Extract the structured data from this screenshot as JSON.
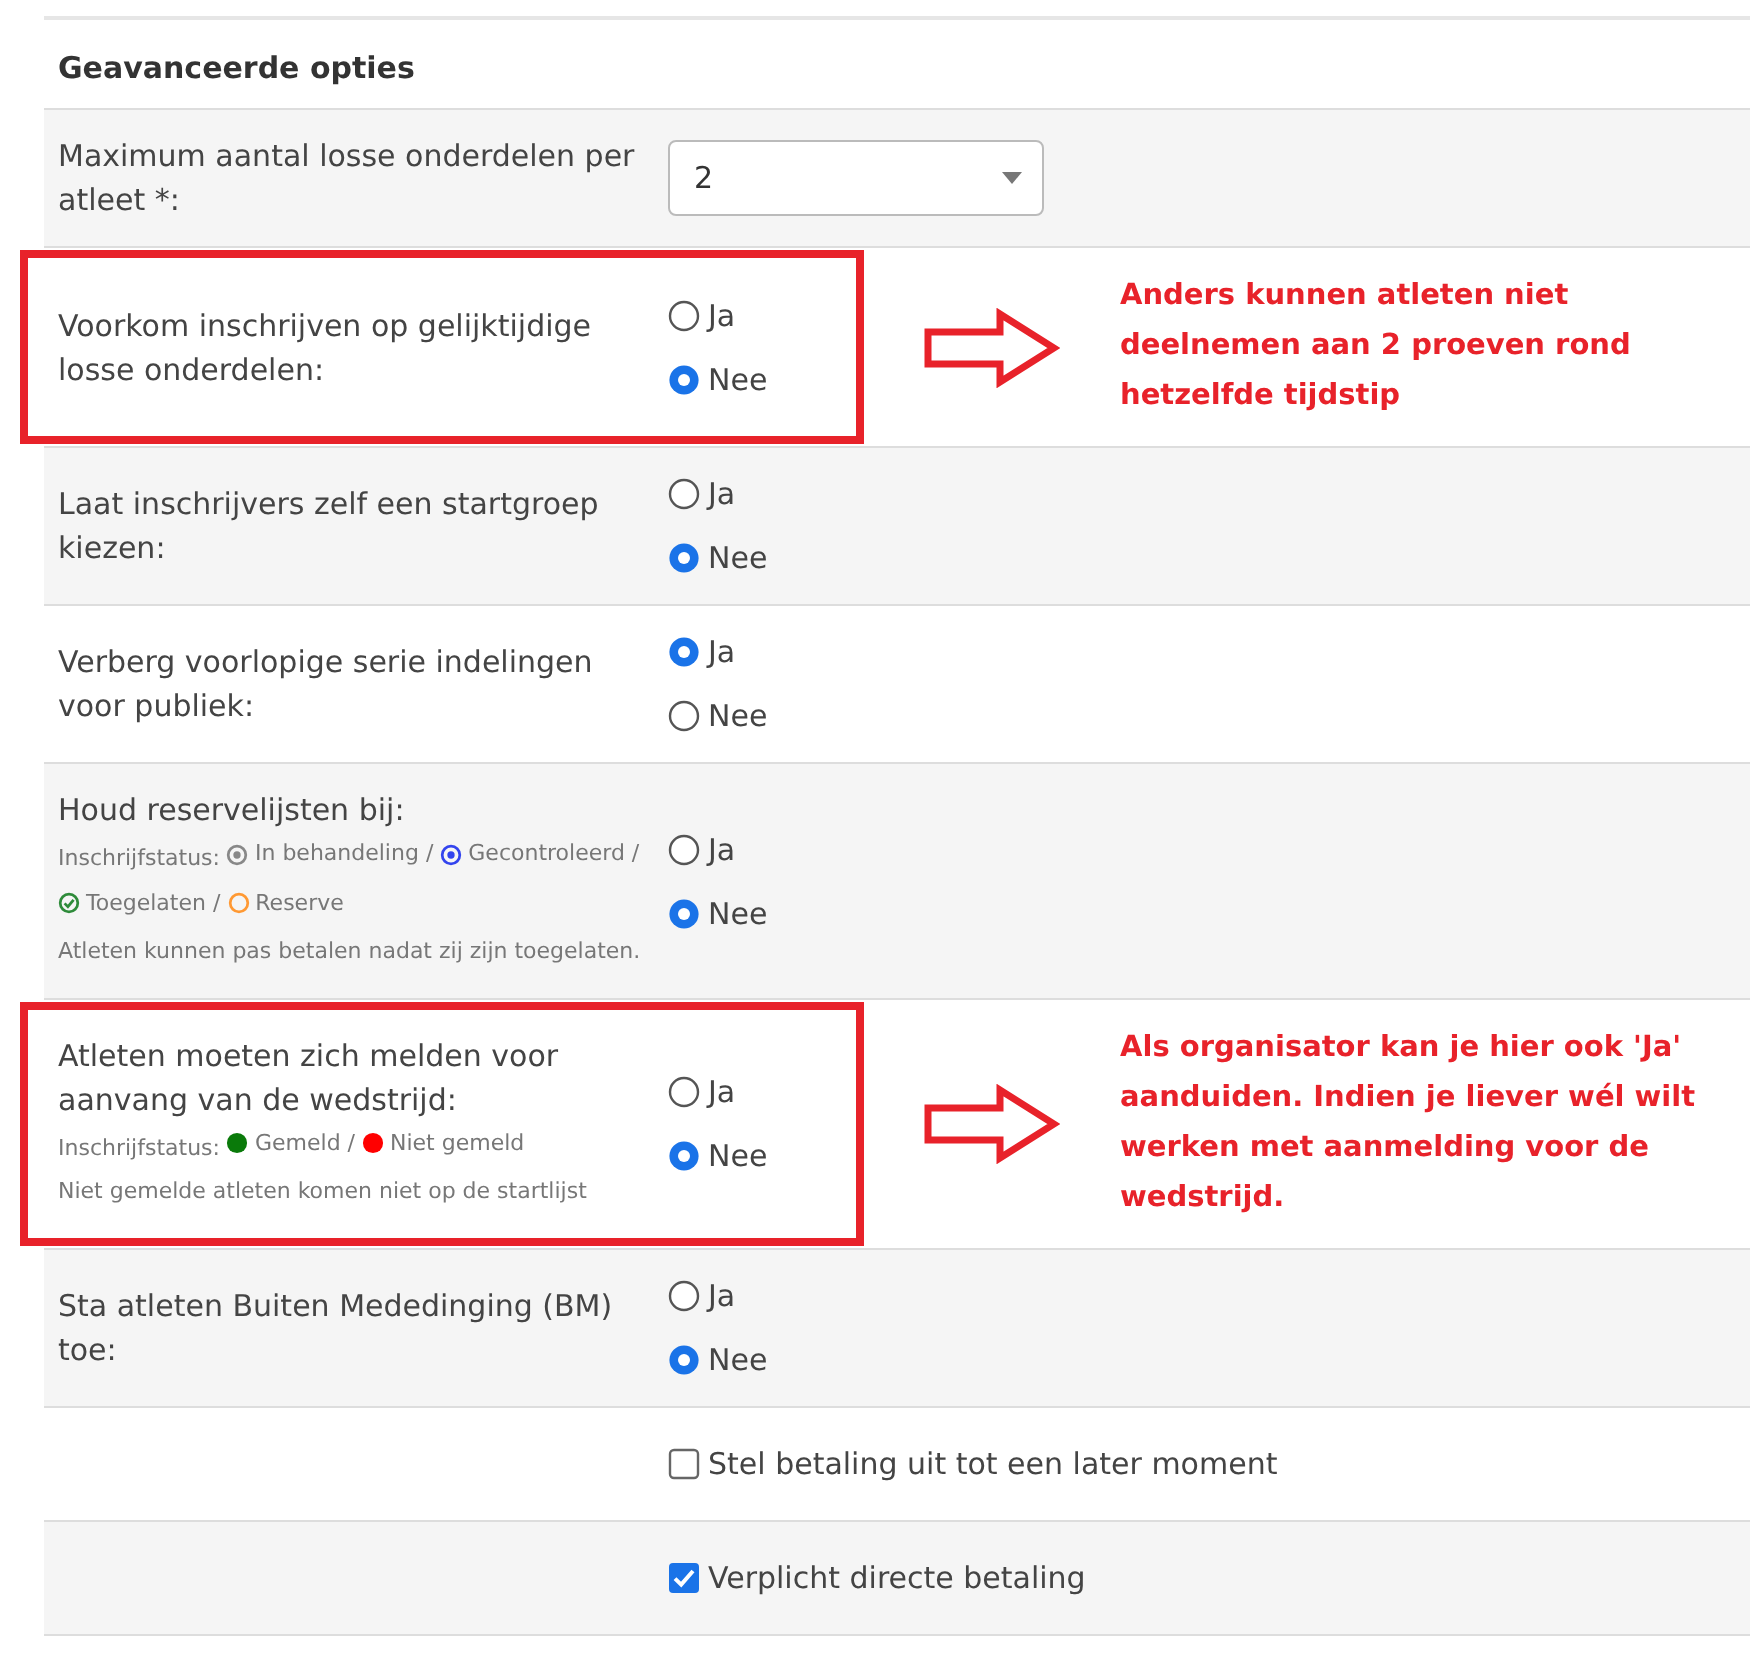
{
  "section": {
    "title": "Geavanceerde opties"
  },
  "rows": [
    {
      "kind": "select",
      "label": "Maximum aantal losse onderdelen per atleet *:",
      "value": "2"
    },
    {
      "kind": "radio",
      "label": "Voorkom inschrijven op gelijktijdige losse onderdelen:",
      "options": [
        {
          "label": "Ja",
          "selected": false
        },
        {
          "label": "Nee",
          "selected": true
        }
      ],
      "annotation": {
        "note": "Anders kunnen atleten niet deelnemen aan 2 proeven rond hetzelfde tijdstip"
      }
    },
    {
      "kind": "radio",
      "label": "Laat inschrijvers zelf een startgroep kiezen:",
      "options": [
        {
          "label": "Ja",
          "selected": false
        },
        {
          "label": "Nee",
          "selected": true
        }
      ]
    },
    {
      "kind": "radio",
      "label": "Verberg voorlopige serie indelingen voor publiek:",
      "options": [
        {
          "label": "Ja",
          "selected": true
        },
        {
          "label": "Nee",
          "selected": false
        }
      ]
    },
    {
      "kind": "radio",
      "label": "Houd reservelijsten bij:",
      "legend": {
        "title": "Inschrijfstatus:",
        "statuses": [
          {
            "label": "In behandeling /",
            "kind": "ring-dot",
            "color": "#888888"
          },
          {
            "label": "Gecontroleerd /",
            "kind": "ring-dot",
            "color": "#3344ee"
          },
          {
            "label": "Toegelaten /",
            "kind": "check",
            "color": "#2e8b3a"
          },
          {
            "label": "Reserve",
            "kind": "ring",
            "color": "#ff9933"
          }
        ],
        "note": "Atleten kunnen pas betalen nadat zij zijn toegelaten."
      },
      "options": [
        {
          "label": "Ja",
          "selected": false
        },
        {
          "label": "Nee",
          "selected": true
        }
      ]
    },
    {
      "kind": "radio",
      "label": "Atleten moeten zich melden voor aanvang van de wedstrijd:",
      "legend": {
        "title": "Inschrijfstatus:",
        "statuses": [
          {
            "label": "Gemeld /",
            "kind": "dot",
            "color": "#0a7a0a"
          },
          {
            "label": "Niet gemeld",
            "kind": "dot",
            "color": "#ff0000"
          }
        ],
        "note": "Niet gemelde atleten komen niet op de startlijst"
      },
      "options": [
        {
          "label": "Ja",
          "selected": false
        },
        {
          "label": "Nee",
          "selected": true
        }
      ],
      "annotation": {
        "note": "Als organisator kan je hier ook 'Ja' aanduiden. Indien je liever wél wilt werken met aanmelding voor de wedstrijd."
      }
    },
    {
      "kind": "radio",
      "label": "Sta atleten Buiten Mededinging (BM) toe:",
      "options": [
        {
          "label": "Ja",
          "selected": false
        },
        {
          "label": "Nee",
          "selected": true
        }
      ]
    },
    {
      "kind": "checkbox",
      "label": "Stel betaling uit tot een later moment",
      "checked": false
    },
    {
      "kind": "checkbox",
      "label": "Verplicht directe betaling",
      "checked": true
    }
  ]
}
